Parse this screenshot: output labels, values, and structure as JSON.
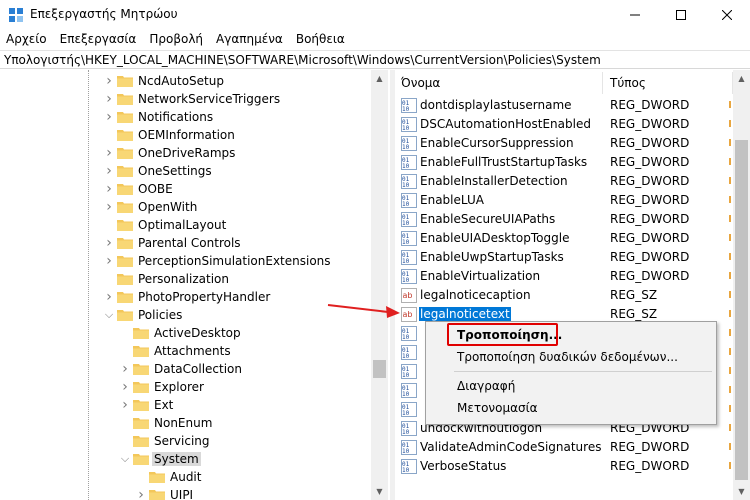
{
  "window": {
    "title": "Επεξεργαστής Μητρώου",
    "minimize": "—",
    "maximize": "☐",
    "close": "✕"
  },
  "menu": [
    "Αρχείο",
    "Επεξεργασία",
    "Προβολή",
    "Αγαπημένα",
    "Βοήθεια"
  ],
  "address": "Υπολογιστής\\HKEY_LOCAL_MACHINE\\SOFTWARE\\Microsoft\\Windows\\CurrentVersion\\Policies\\System",
  "tree": [
    {
      "label": "NcdAutoSetup",
      "level": 0,
      "chevron": "right"
    },
    {
      "label": "NetworkServiceTriggers",
      "level": 0,
      "chevron": "right"
    },
    {
      "label": "Notifications",
      "level": 0,
      "chevron": "right"
    },
    {
      "label": "OEMInformation",
      "level": 0,
      "chevron": "none"
    },
    {
      "label": "OneDriveRamps",
      "level": 0,
      "chevron": "right"
    },
    {
      "label": "OneSettings",
      "level": 0,
      "chevron": "right"
    },
    {
      "label": "OOBE",
      "level": 0,
      "chevron": "right"
    },
    {
      "label": "OpenWith",
      "level": 0,
      "chevron": "right"
    },
    {
      "label": "OptimalLayout",
      "level": 0,
      "chevron": "none"
    },
    {
      "label": "Parental Controls",
      "level": 0,
      "chevron": "right"
    },
    {
      "label": "PerceptionSimulationExtensions",
      "level": 0,
      "chevron": "right"
    },
    {
      "label": "Personalization",
      "level": 0,
      "chevron": "none"
    },
    {
      "label": "PhotoPropertyHandler",
      "level": 0,
      "chevron": "right"
    },
    {
      "label": "Policies",
      "level": 0,
      "chevron": "down"
    },
    {
      "label": "ActiveDesktop",
      "level": 1,
      "chevron": "none"
    },
    {
      "label": "Attachments",
      "level": 1,
      "chevron": "none"
    },
    {
      "label": "DataCollection",
      "level": 1,
      "chevron": "right"
    },
    {
      "label": "Explorer",
      "level": 1,
      "chevron": "right"
    },
    {
      "label": "Ext",
      "level": 1,
      "chevron": "right"
    },
    {
      "label": "NonEnum",
      "level": 1,
      "chevron": "none"
    },
    {
      "label": "Servicing",
      "level": 1,
      "chevron": "none"
    },
    {
      "label": "System",
      "level": 1,
      "chevron": "down",
      "selected": true
    },
    {
      "label": "Audit",
      "level": 2,
      "chevron": "none"
    },
    {
      "label": "UIPI",
      "level": 2,
      "chevron": "right"
    }
  ],
  "values": {
    "col_name": "Όνομα",
    "col_type": "Τύπος",
    "rows": [
      {
        "name": "dontdisplaylastusername",
        "type": "REG_DWORD",
        "kind": "dword"
      },
      {
        "name": "DSCAutomationHostEnabled",
        "type": "REG_DWORD",
        "kind": "dword"
      },
      {
        "name": "EnableCursorSuppression",
        "type": "REG_DWORD",
        "kind": "dword"
      },
      {
        "name": "EnableFullTrustStartupTasks",
        "type": "REG_DWORD",
        "kind": "dword"
      },
      {
        "name": "EnableInstallerDetection",
        "type": "REG_DWORD",
        "kind": "dword"
      },
      {
        "name": "EnableLUA",
        "type": "REG_DWORD",
        "kind": "dword"
      },
      {
        "name": "EnableSecureUIAPaths",
        "type": "REG_DWORD",
        "kind": "dword"
      },
      {
        "name": "EnableUIADesktopToggle",
        "type": "REG_DWORD",
        "kind": "dword"
      },
      {
        "name": "EnableUwpStartupTasks",
        "type": "REG_DWORD",
        "kind": "dword"
      },
      {
        "name": "EnableVirtualization",
        "type": "REG_DWORD",
        "kind": "dword"
      },
      {
        "name": "legalnoticecaption",
        "type": "REG_SZ",
        "kind": "sz"
      },
      {
        "name": "legalnoticetext",
        "type": "REG_SZ",
        "kind": "sz",
        "selected": true
      },
      {
        "name": "",
        "type": "",
        "kind": "dword"
      },
      {
        "name": "",
        "type": "",
        "kind": "dword"
      },
      {
        "name": "",
        "type": "",
        "kind": "dword"
      },
      {
        "name": "",
        "type": "",
        "kind": "dword"
      },
      {
        "name": "",
        "type": "",
        "kind": "dword"
      },
      {
        "name": "undockwithoutlogon",
        "type": "REG_DWORD",
        "kind": "dword"
      },
      {
        "name": "ValidateAdminCodeSignatures",
        "type": "REG_DWORD",
        "kind": "dword"
      },
      {
        "name": "VerboseStatus",
        "type": "REG_DWORD",
        "kind": "dword"
      }
    ]
  },
  "context_menu": {
    "modify": "Τροποποίηση...",
    "modify_binary": "Τροποποίηση δυαδικών δεδομένων...",
    "delete": "Διαγραφή",
    "rename": "Μετονομασία"
  },
  "colors": {
    "folder": "#f3c75a",
    "selection": "#0078d7",
    "highlight_box": "#e00000",
    "arrow": "#e02020"
  }
}
